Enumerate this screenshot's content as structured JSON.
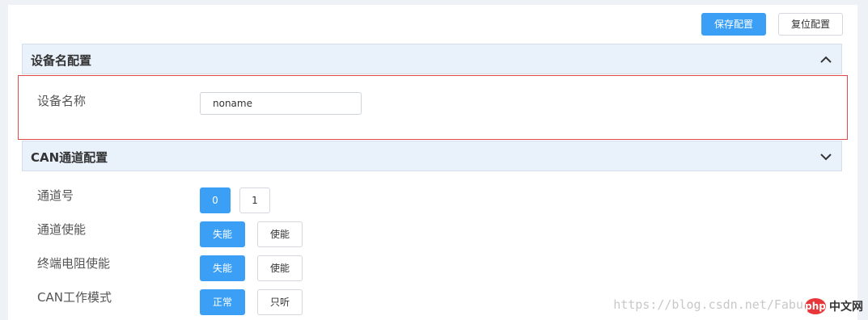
{
  "toolbar": {
    "save_label": "保存配置",
    "reset_label": "复位配置"
  },
  "device_section": {
    "title": "设备名配置",
    "expanded": true,
    "name_label": "设备名称",
    "name_value": "noname",
    "chevron_icon": "chevron-up-icon"
  },
  "can_section": {
    "title": "CAN通道配置",
    "expanded": false,
    "chevron_icon": "chevron-down-icon",
    "rows": {
      "channel": {
        "label": "通道号",
        "options": [
          "0",
          "1"
        ],
        "selected": "0"
      },
      "enable": {
        "label": "通道使能",
        "options": [
          "失能",
          "使能"
        ],
        "selected": "失能"
      },
      "termination": {
        "label": "终端电阻使能",
        "options": [
          "失能",
          "使能"
        ],
        "selected": "失能"
      },
      "mode": {
        "label": "CAN工作模式",
        "options": [
          "正常",
          "只听"
        ],
        "selected": "正常"
      }
    }
  },
  "watermark": "https://blog.csdn.net/Fabu",
  "logo": {
    "badge": "php",
    "text": "中文网"
  },
  "colors": {
    "primary": "#3a9ff5",
    "header_bg": "#e9f1fb",
    "highlight": "#e04a4a"
  }
}
